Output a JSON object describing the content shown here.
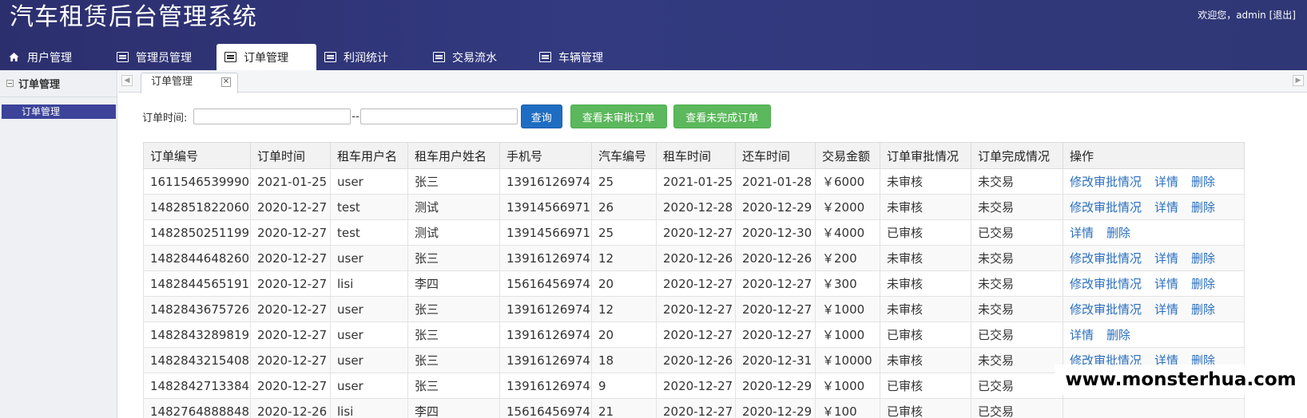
{
  "header": {
    "title": "汽车租赁后台管理系统",
    "user_text": "欢迎您，admin",
    "logout_text": "[退出]"
  },
  "nav": {
    "tabs": [
      {
        "label": "用户管理",
        "icon": "home-icon"
      },
      {
        "label": "管理员管理",
        "icon": "document-icon"
      },
      {
        "label": "订单管理",
        "icon": "document-icon"
      },
      {
        "label": "利润统计",
        "icon": "document-icon"
      },
      {
        "label": "交易流水",
        "icon": "document-icon"
      },
      {
        "label": "车辆管理",
        "icon": "document-icon"
      }
    ],
    "active_index": 2
  },
  "sidebar": {
    "section_title": "订单管理",
    "items": [
      {
        "label": "订单管理"
      }
    ]
  },
  "content_tab": {
    "label": "订单管理",
    "close_symbol": "✕"
  },
  "filter": {
    "label": "订单时间:",
    "separator": "--",
    "start_value": "",
    "end_value": "",
    "query_button": "查询",
    "unapproved_button": "查看未审批订单",
    "unfinished_button": "查看未完成订单"
  },
  "table": {
    "columns": [
      "订单编号",
      "订单时间",
      "租车用户名",
      "租车用户姓名",
      "手机号",
      "汽车编号",
      "租车时间",
      "还车时间",
      "交易金额",
      "订单审批情况",
      "订单完成情况",
      "操作"
    ],
    "action_labels": {
      "modify": "修改审批情况",
      "detail": "详情",
      "delete": "删除"
    },
    "rows": [
      {
        "cells": [
          "1611546539990",
          "2021-01-25",
          "user",
          "张三",
          "13916126974",
          "25",
          "2021-01-25",
          "2021-01-28",
          "￥6000",
          "未审核",
          "未交易"
        ],
        "actions": [
          "modify",
          "detail",
          "delete"
        ]
      },
      {
        "cells": [
          "1482851822060",
          "2020-12-27",
          "test",
          "测试",
          "13914566971",
          "26",
          "2020-12-28",
          "2020-12-29",
          "￥2000",
          "未审核",
          "未交易"
        ],
        "actions": [
          "modify",
          "detail",
          "delete"
        ]
      },
      {
        "cells": [
          "1482850251199",
          "2020-12-27",
          "test",
          "测试",
          "13914566971",
          "25",
          "2020-12-27",
          "2020-12-30",
          "￥4000",
          "已审核",
          "已交易"
        ],
        "actions": [
          "detail",
          "delete"
        ]
      },
      {
        "cells": [
          "1482844648260",
          "2020-12-27",
          "user",
          "张三",
          "13916126974",
          "12",
          "2020-12-26",
          "2020-12-26",
          "￥200",
          "未审核",
          "未交易"
        ],
        "actions": [
          "modify",
          "detail",
          "delete"
        ]
      },
      {
        "cells": [
          "1482844565191",
          "2020-12-27",
          "lisi",
          "李四",
          "15616456974",
          "20",
          "2020-12-27",
          "2020-12-27",
          "￥300",
          "未审核",
          "未交易"
        ],
        "actions": [
          "modify",
          "detail",
          "delete"
        ]
      },
      {
        "cells": [
          "1482843675726",
          "2020-12-27",
          "user",
          "张三",
          "13916126974",
          "12",
          "2020-12-27",
          "2020-12-27",
          "￥1000",
          "未审核",
          "未交易"
        ],
        "actions": [
          "modify",
          "detail",
          "delete"
        ]
      },
      {
        "cells": [
          "1482843289819",
          "2020-12-27",
          "user",
          "张三",
          "13916126974",
          "20",
          "2020-12-27",
          "2020-12-27",
          "￥1000",
          "已审核",
          "已交易"
        ],
        "actions": [
          "detail",
          "delete"
        ]
      },
      {
        "cells": [
          "1482843215408",
          "2020-12-27",
          "user",
          "张三",
          "13916126974",
          "18",
          "2020-12-26",
          "2020-12-31",
          "￥10000",
          "未审核",
          "未交易"
        ],
        "actions": [
          "modify",
          "detail",
          "delete"
        ]
      },
      {
        "cells": [
          "1482842713384",
          "2020-12-27",
          "user",
          "张三",
          "13916126974",
          "9",
          "2020-12-27",
          "2020-12-29",
          "￥1000",
          "已审核",
          "已交易"
        ],
        "actions": []
      },
      {
        "cells": [
          "1482764888848",
          "2020-12-26",
          "lisi",
          "李四",
          "15616456974",
          "21",
          "2020-12-27",
          "2020-12-29",
          "￥100",
          "已审核",
          "已交易"
        ],
        "actions": []
      }
    ]
  },
  "watermark": "www.monsterhua.com",
  "colors": {
    "header_bg": "#2f3576",
    "sidebar_active": "#3c4399",
    "primary_button": "#1f6dc2",
    "success_button": "#5cb85c",
    "link": "#2a6fbf"
  }
}
